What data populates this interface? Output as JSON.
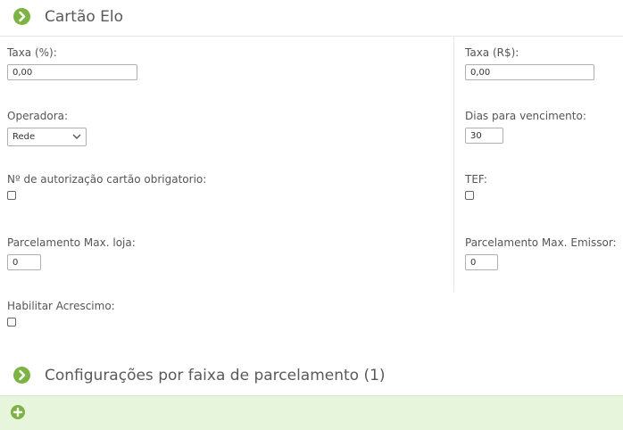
{
  "sections": {
    "main_title": "Cartão Elo",
    "faixa_title": "Configurações por faixa de parcelamento (1)"
  },
  "fields": {
    "taxa_pct": {
      "label": "Taxa (%):",
      "value": "0,00"
    },
    "taxa_rs": {
      "label": "Taxa (R$):",
      "value": "0,00"
    },
    "operadora": {
      "label": "Operadora:",
      "selected": "Rede"
    },
    "dias_vencimento": {
      "label": "Dias para vencimento:",
      "value": "30"
    },
    "autorizacao": {
      "label": "Nº de autorização cartão obrigatorio:",
      "checked": false
    },
    "tef": {
      "label": "TEF:",
      "checked": false
    },
    "parcelamento_loja": {
      "label": "Parcelamento Max. loja:",
      "value": "0"
    },
    "parcelamento_emissor": {
      "label": "Parcelamento Max. Emissor:",
      "value": "0"
    },
    "habilitar_acrescimo": {
      "label": "Habilitar Acrescimo:",
      "checked": false
    }
  },
  "icons": {
    "section_icon": "chevron-right-circle-icon",
    "add_icon": "plus-circle-icon"
  },
  "colors": {
    "accent_green": "#7cb342",
    "add_bar_bg": "#e6f5dc",
    "title_text": "#5a5a5a"
  }
}
